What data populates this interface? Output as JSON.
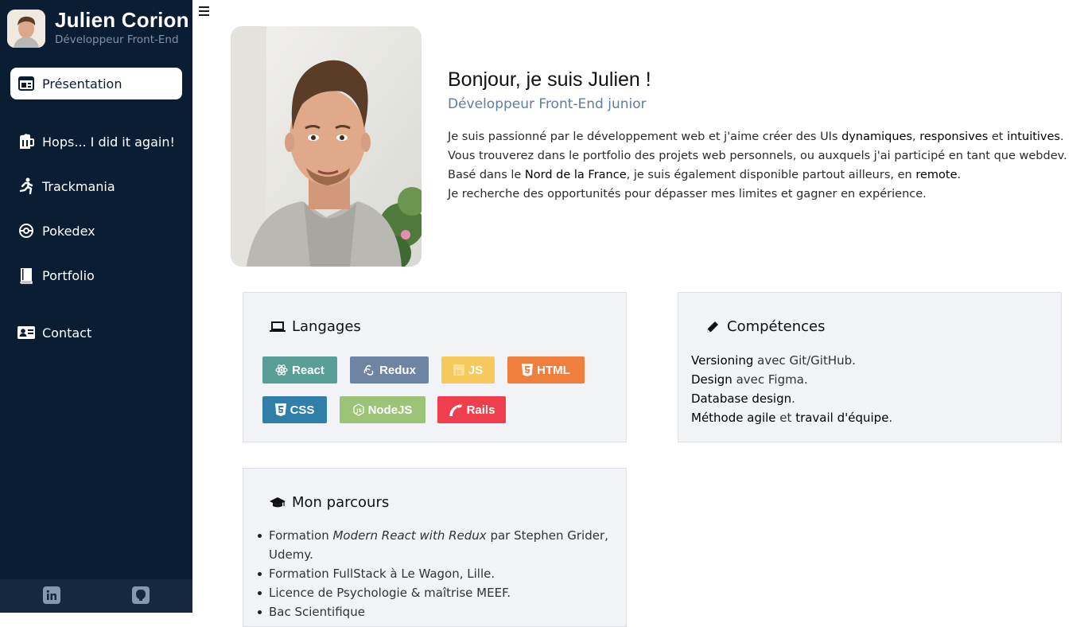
{
  "profile": {
    "name": "Julien Corion",
    "subtitle": "Développeur Front-End"
  },
  "nav": {
    "items": [
      {
        "label": "Présentation",
        "icon": "presentation-icon",
        "active": true
      },
      {
        "label": "Hops... I did it again!",
        "icon": "beer-mug-icon"
      },
      {
        "label": "Trackmania",
        "icon": "running-icon"
      },
      {
        "label": "Pokedex",
        "icon": "pokeball-icon"
      },
      {
        "label": "Portfolio",
        "icon": "book-icon"
      },
      {
        "label": "Contact",
        "icon": "contact-card-icon"
      }
    ]
  },
  "footer": {
    "links": [
      {
        "icon": "linkedin-icon"
      },
      {
        "icon": "github-icon"
      }
    ]
  },
  "intro": {
    "greeting": "Bonjour, je suis Julien !",
    "role": "Développeur Front-End junior",
    "p1_a": "Je suis passionné par le développement web et j'aime créer des UIs ",
    "p1_b": "dynamiques",
    "p1_c": ", ",
    "p1_d": "responsives",
    "p1_e": " et ",
    "p1_f": "intuitives",
    "p1_g": ".",
    "p2": "Vous trouverez dans le portfolio des projets web personnels, ou auxquels j'ai participé en tant que webdev.",
    "p3_a": "Basé dans le ",
    "p3_b": "Nord de la France",
    "p3_c": ", je suis également disponible partout ailleurs, en ",
    "p3_d": "remote",
    "p3_e": ".",
    "p4": "Je recherche des opportunités pour dépasser mes limites et gagner en expérience."
  },
  "langages": {
    "title": "Langages",
    "badges": [
      {
        "label": "React",
        "color": "#5a9e98"
      },
      {
        "label": "Redux",
        "color": "#6d84a3"
      },
      {
        "label": "JS",
        "color": "#f7c85c"
      },
      {
        "label": "HTML",
        "color": "#f07e3d"
      },
      {
        "label": "CSS",
        "color": "#2f7fa9"
      },
      {
        "label": "NodeJS",
        "color": "#9cc478"
      },
      {
        "label": "Rails",
        "color": "#ef3f4c"
      }
    ]
  },
  "competences": {
    "title": "Compétences",
    "l1_a": "Versioning",
    "l1_b": " avec Git/GitHub.",
    "l2_a": "Design",
    "l2_b": " avec Figma.",
    "l3_a": "Database design",
    "l3_b": ".",
    "l4_a": "Méthode agile",
    "l4_b": " et ",
    "l4_c": "travail d'équipe",
    "l4_d": "."
  },
  "parcours": {
    "title": "Mon parcours",
    "i1_a": "Formation ",
    "i1_b": "Modern React with Redux",
    "i1_c": " par Stephen Grider, Udemy.",
    "i2": "Formation FullStack à Le Wagon, Lille.",
    "i3": "Licence de Psychologie & maîtrise MEEF.",
    "i4": "Bac Scientifique"
  }
}
